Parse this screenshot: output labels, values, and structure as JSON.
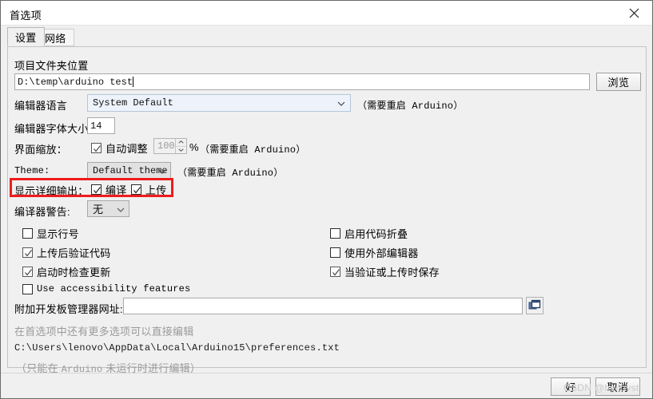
{
  "window": {
    "title": "首选项",
    "close_icon": "close-icon"
  },
  "tabs": [
    {
      "label": "设置",
      "active": true
    },
    {
      "label": "网络",
      "active": false
    }
  ],
  "sketchbook": {
    "label": "项目文件夹位置",
    "path_value": "D:\\temp\\arduino test",
    "browse_label": "浏览"
  },
  "language": {
    "label": "编辑器语言",
    "value": "System Default",
    "note": "（需要重启 Arduino）"
  },
  "font_size": {
    "label": "编辑器字体大小",
    "value": "14"
  },
  "scaling": {
    "label": "界面缩放：",
    "auto_label": "自动调整",
    "auto_checked": true,
    "percent_value": "100",
    "percent_suffix": "%",
    "note": "（需要重启 Arduino）"
  },
  "theme": {
    "label": "Theme:",
    "value": "Default theme",
    "note": "（需要重启 Arduino）"
  },
  "verbose": {
    "label": "显示详细输出：",
    "compile_label": "编译",
    "compile_checked": true,
    "upload_label": "上传",
    "upload_checked": true,
    "highlight_color": "#ee1c1c"
  },
  "warnings": {
    "label": "编译器警告:",
    "value": "无"
  },
  "checkboxes_left": [
    {
      "label": "显示行号",
      "checked": false,
      "mono": false
    },
    {
      "label": "上传后验证代码",
      "checked": true,
      "mono": false
    },
    {
      "label": "启动时检查更新",
      "checked": true,
      "mono": false
    },
    {
      "label": "Use accessibility features",
      "checked": false,
      "mono": true
    }
  ],
  "checkboxes_right": [
    {
      "label": "启用代码折叠",
      "checked": false,
      "mono": false
    },
    {
      "label": "使用外部编辑器",
      "checked": false,
      "mono": false
    },
    {
      "label": "当验证或上传时保存",
      "checked": true,
      "mono": false
    }
  ],
  "board_urls": {
    "label": "附加开发板管理器网址:",
    "value": "",
    "edit_icon": "window-duplicate-icon"
  },
  "prefs_note": {
    "line1": "在首选项中还有更多选项可以直接编辑",
    "line2": "C:\\Users\\lenovo\\AppData\\Local\\Arduino15\\preferences.txt",
    "line3_pre": "（只能在 ",
    "line3_mono": "Arduino",
    "line3_post": " 未运行时进行编辑）"
  },
  "footer": {
    "ok_label": "好",
    "cancel_label": "取消"
  },
  "watermark": {
    "text": "CSDN @hellovst"
  }
}
